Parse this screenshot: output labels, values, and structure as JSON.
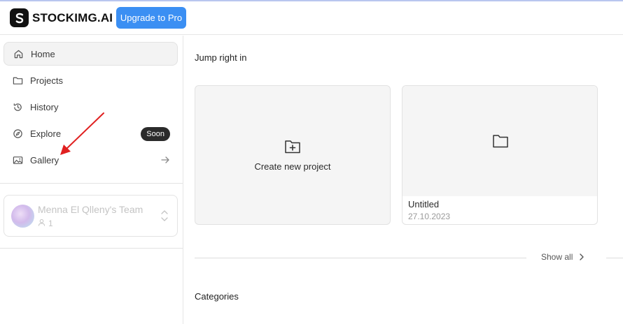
{
  "header": {
    "logo_text": "STOCKIMG.AI",
    "upgrade_label": "Upgrade to Pro"
  },
  "sidebar": {
    "items": [
      {
        "label": "Home",
        "icon": "home-icon"
      },
      {
        "label": "Projects",
        "icon": "folder-icon"
      },
      {
        "label": "History",
        "icon": "history-icon"
      },
      {
        "label": "Explore",
        "icon": "compass-icon",
        "badge": "Soon"
      },
      {
        "label": "Gallery",
        "icon": "image-icon"
      }
    ],
    "team": {
      "name": "Menna El Qlleny's Team",
      "member_count": "1"
    }
  },
  "main": {
    "jump_title": "Jump right in",
    "create_label": "Create new project",
    "project": {
      "name": "Untitled",
      "date": "27.10.2023"
    },
    "show_all_label": "Show all",
    "categories_title": "Categories"
  },
  "colors": {
    "accent": "#3b8ff3",
    "badge_bg": "#2b2b2b",
    "annotation_arrow": "#e02020"
  }
}
